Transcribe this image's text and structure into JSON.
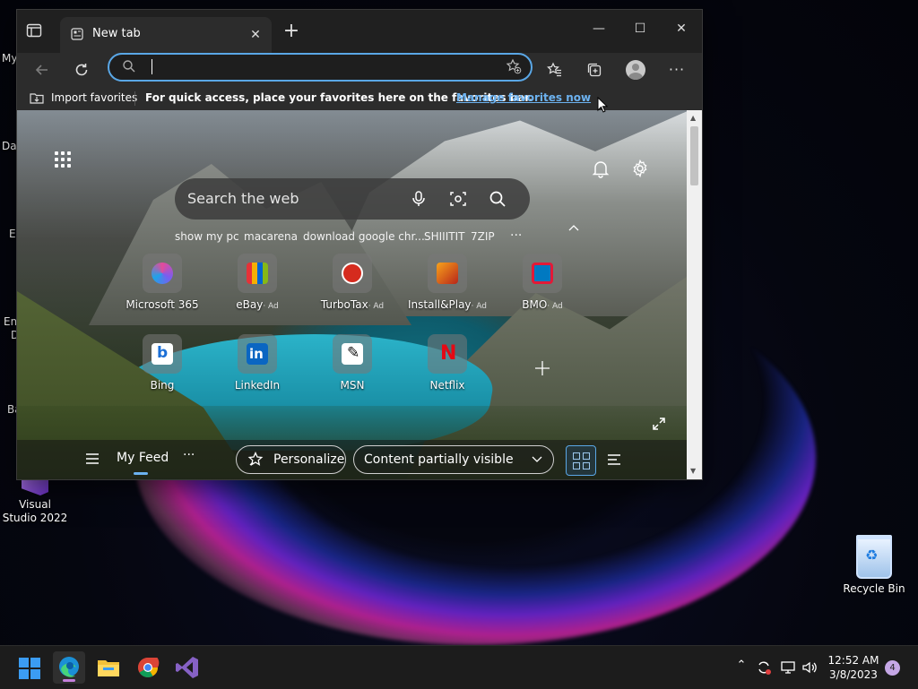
{
  "desktop": {
    "icons": [
      {
        "label": "Recycle Bin"
      },
      {
        "label": "Visual Studio 2022"
      }
    ],
    "left_partial_labels": [
      "My",
      "Da",
      "E",
      "Em",
      "D",
      "Ba"
    ]
  },
  "browser": {
    "tab": {
      "title": "New tab"
    },
    "address": {
      "value": "",
      "placeholder": ""
    },
    "favorites_bar": {
      "import_label": "Import favorites",
      "hint": "For quick access, place your favorites here on the favorites bar.",
      "manage_link": "Manage favorites now"
    },
    "newtab": {
      "search_placeholder": "Search the web",
      "chips": [
        "show my pc",
        "macarena",
        "download google chr...",
        "SHIIITIT",
        "7ZIP"
      ],
      "tiles": [
        {
          "label": "Microsoft 365",
          "ad": ""
        },
        {
          "label": "eBay",
          "ad": "· Ad"
        },
        {
          "label": "TurboTax",
          "ad": "· Ad"
        },
        {
          "label": "Install&Play",
          "ad": "· Ad"
        },
        {
          "label": "BMO",
          "ad": "· Ad"
        },
        {
          "label": "Bing",
          "ad": ""
        },
        {
          "label": "LinkedIn",
          "ad": ""
        },
        {
          "label": "MSN",
          "ad": ""
        },
        {
          "label": "Netflix",
          "ad": ""
        }
      ],
      "feed": {
        "my_feed": "My Feed",
        "personalize": "Personalize",
        "content_visibility": "Content partially visible"
      }
    }
  },
  "taskbar": {
    "time": "12:52 AM",
    "date": "3/8/2023",
    "notification_count": "4"
  },
  "colors": {
    "accent": "#5aa7e6",
    "link": "#6cb2f0",
    "edge_indicator": "#c47fdc"
  }
}
